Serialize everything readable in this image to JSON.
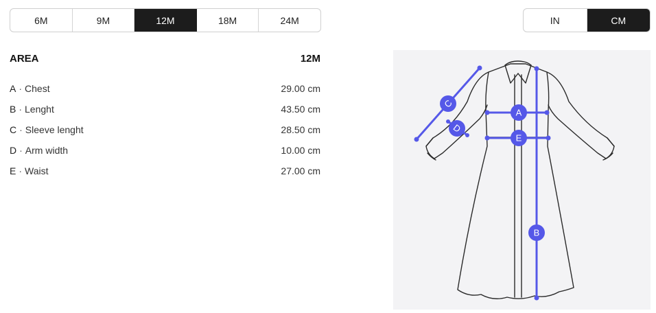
{
  "sizes": {
    "options": [
      "6M",
      "9M",
      "12M",
      "18M",
      "24M"
    ],
    "selected": "12M"
  },
  "units": {
    "options": [
      "IN",
      "CM"
    ],
    "selected": "CM"
  },
  "table": {
    "area_header": "AREA",
    "size_header": "12M",
    "rows": [
      {
        "letter": "A",
        "name": "Chest",
        "value": "29.00 cm"
      },
      {
        "letter": "B",
        "name": "Lenght",
        "value": "43.50 cm"
      },
      {
        "letter": "C",
        "name": "Sleeve lenght",
        "value": "28.50 cm"
      },
      {
        "letter": "D",
        "name": "Arm width",
        "value": "10.00 cm"
      },
      {
        "letter": "E",
        "name": "Waist",
        "value": "27.00 cm"
      }
    ]
  },
  "diagram": {
    "markers": [
      "A",
      "B",
      "C",
      "D",
      "E"
    ],
    "accent_color": "#5558e8",
    "garment": "long-sleeve-dress-icon"
  },
  "colors": {
    "active_bg": "#1c1c1c",
    "panel_bg": "#f3f3f5"
  }
}
